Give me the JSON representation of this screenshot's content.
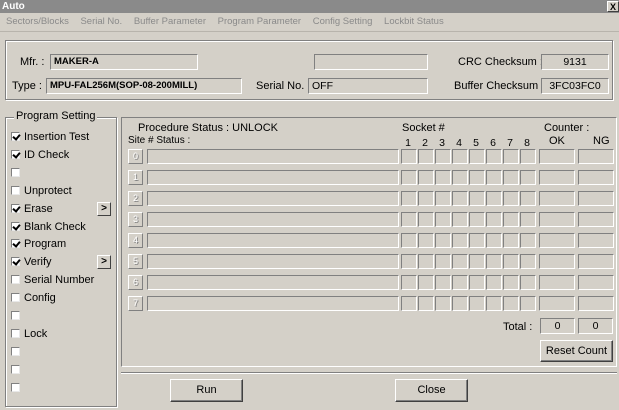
{
  "window": {
    "title": "Auto",
    "close_glyph": "X"
  },
  "menu": [
    "Sectors/Blocks",
    "Serial No.",
    "Buffer Parameter",
    "Program Parameter",
    "Config Setting",
    "Lockbit Status"
  ],
  "info": {
    "mfr_label": "Mfr. :",
    "mfr_value": "MAKER-A",
    "type_label": "Type :",
    "type_value": "MPU-FAL256M(SOP-08-200MILL)",
    "serial_label": "Serial No. :",
    "serial_value": "OFF",
    "blank_value": "",
    "crc_label": "CRC Checksum :",
    "crc_value": "9131",
    "buffer_label": "Buffer Checksum :",
    "buffer_value": "3FC03FC0"
  },
  "program_setting": {
    "legend": "Program Setting",
    "items": [
      {
        "label": "Insertion Test",
        "checked": true
      },
      {
        "label": "ID Check",
        "checked": true
      },
      {
        "label": "",
        "checked": false
      },
      {
        "label": "Unprotect",
        "checked": false
      },
      {
        "label": "Erase",
        "checked": true,
        "arrow": ">"
      },
      {
        "label": "Blank Check",
        "checked": true
      },
      {
        "label": "Program",
        "checked": true
      },
      {
        "label": "Verify",
        "checked": true,
        "arrow": ">"
      },
      {
        "label": "Serial Number",
        "checked": false
      },
      {
        "label": "Config",
        "checked": false
      },
      {
        "label": "",
        "checked": false
      },
      {
        "label": "Lock",
        "checked": false
      },
      {
        "label": "",
        "checked": false
      },
      {
        "label": "",
        "checked": false
      },
      {
        "label": "",
        "checked": false
      }
    ]
  },
  "status": {
    "procedure": "Procedure Status : UNLOCK",
    "site_status": "Site # Status :",
    "socket_label": "Socket #",
    "counter_label": "Counter :",
    "ok_label": "OK",
    "ng_label": "NG",
    "sockets": [
      "1",
      "2",
      "3",
      "4",
      "5",
      "6",
      "7",
      "8"
    ],
    "sites": [
      "0",
      "1",
      "2",
      "3",
      "4",
      "5",
      "6",
      "7"
    ],
    "total_label": "Total :",
    "total_ok": "0",
    "total_ng": "0",
    "reset_label": "Reset Count"
  },
  "buttons": {
    "run": "Run",
    "close": "Close"
  }
}
